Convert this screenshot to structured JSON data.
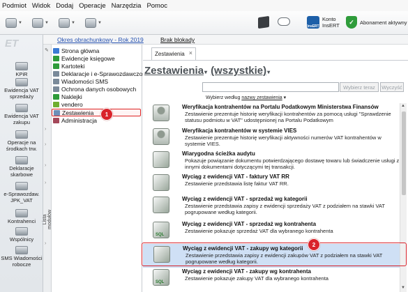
{
  "menu": [
    "Podmiot",
    "Widok",
    "Dodaj",
    "Operacje",
    "Narzędzia",
    "Pomoc"
  ],
  "toolbar": {
    "account_line1": "Konto",
    "account_line2": "InsERT",
    "account_logo_text": "InsERT",
    "subscription": "Abonament aktywny"
  },
  "infobar": {
    "period": "Okres obrachunkowy - Rok 2019",
    "blockade": "Brak blokady"
  },
  "leftnav": {
    "brand": "ET",
    "items": [
      {
        "label": "KPiR"
      },
      {
        "label": "Ewidencja VAT sprzedaży"
      },
      {
        "label": "Ewidencja VAT zakupu"
      },
      {
        "label": "Operacje na środkach trw."
      },
      {
        "label": "Deklaracje skarbowe"
      },
      {
        "label": "e-Sprawozdaw. JPK_VAT"
      },
      {
        "label": "Kontrahenci"
      },
      {
        "label": "Wspólnicy"
      },
      {
        "label": "SMS Wiadomości robocze"
      }
    ]
  },
  "strip_label": "Lista modułów",
  "tree": [
    {
      "label": "Strona główna",
      "color": "#3b7bd4"
    },
    {
      "label": "Ewidencje księgowe",
      "color": "#2e9b3a"
    },
    {
      "label": "Kartoteki",
      "color": "#2e9b3a"
    },
    {
      "label": "Deklaracje i e-Sprawozdawczość",
      "color": "#7a8a9a"
    },
    {
      "label": "Wiadomości SMS",
      "color": "#7a8a9a"
    },
    {
      "label": "Ochrona danych osobowych",
      "color": "#7a8a9a"
    },
    {
      "label": "Naklejki",
      "color": "#2e9b3a"
    },
    {
      "label": "vendero",
      "color": "#6fae2f"
    },
    {
      "label": "Zestawienia",
      "color": "#6c8fb8",
      "selected": true
    },
    {
      "label": "Administracja",
      "color": "#a4485a"
    }
  ],
  "badges": {
    "first": "1",
    "second": "2"
  },
  "content": {
    "tab_label": "Zestawienia",
    "tab_close": "×",
    "heading": "Zestawienia",
    "heading_arrow": "▾",
    "filter": "(wszystkie)",
    "search_placeholder": "",
    "choose_button": "Wybierz teraz",
    "clear_button": "Wyczyść",
    "choose_prefix": "Wybierz według",
    "choose_link": "nazwy zestawienia",
    "choose_arrow": "▾"
  },
  "reports": [
    {
      "title": "Weryfikacja kontrahentów na Portalu Podatkowym Ministerstwa Finansów",
      "desc": "Zestawienie prezentuje historię weryfikacji kontrahentów za pomocą usługi \"Sprawdzenie statusu podmiotu w VAT\" udostępnionej na Portalu Podatkowym",
      "icon": "person"
    },
    {
      "title": "Weryfikacja kontrahentów w systemie VIES",
      "desc": "Zestawienie prezentuje historię weryfikacji aktywności numerów VAT kontrahentów w systemie VIES.",
      "icon": "person"
    },
    {
      "title": "Wiarygodna ścieżka audytu",
      "desc": "Pokazuje powiązanie dokumentu potwierdzającego dostawę towaru lub świadczenie usługi z innymi dokumentami dotyczącymi tej transakcji.",
      "icon": "stack"
    },
    {
      "title": "Wyciąg z ewidencji VAT - faktury VAT RR",
      "desc": "Zestawienie przedstawia listę faktur VAT RR.",
      "icon": "stack"
    },
    {
      "title": "Wyciąg z ewidencji VAT - sprzedaż wg kategorii",
      "desc": "Zestawienie przedstawia zapisy z ewidencji sprzedaży VAT z podziałem na stawki VAT pogrupowane według kategorii.",
      "icon": "stack"
    },
    {
      "title": "Wyciąg z ewidencji VAT - sprzedaż wg kontrahenta",
      "desc": "Zestawienie pokazuje sprzedaż VAT dla wybranego kontrahenta",
      "icon": "sql"
    },
    {
      "title": "Wyciąg z ewidencji VAT - zakupy wg kategorii",
      "desc": "Zestawienie przedstawia zapisy z ewidencji zakupów VAT z podziałem na stawki VAT pogrupowane według kategorii.",
      "icon": "stack",
      "highlighted": true
    },
    {
      "title": "Wyciąg z ewidencji VAT - zakupy wg kontrahenta",
      "desc": "Zestawienie pokazuje zakupy VAT dla wybranego kontrahenta",
      "icon": "sql"
    }
  ]
}
